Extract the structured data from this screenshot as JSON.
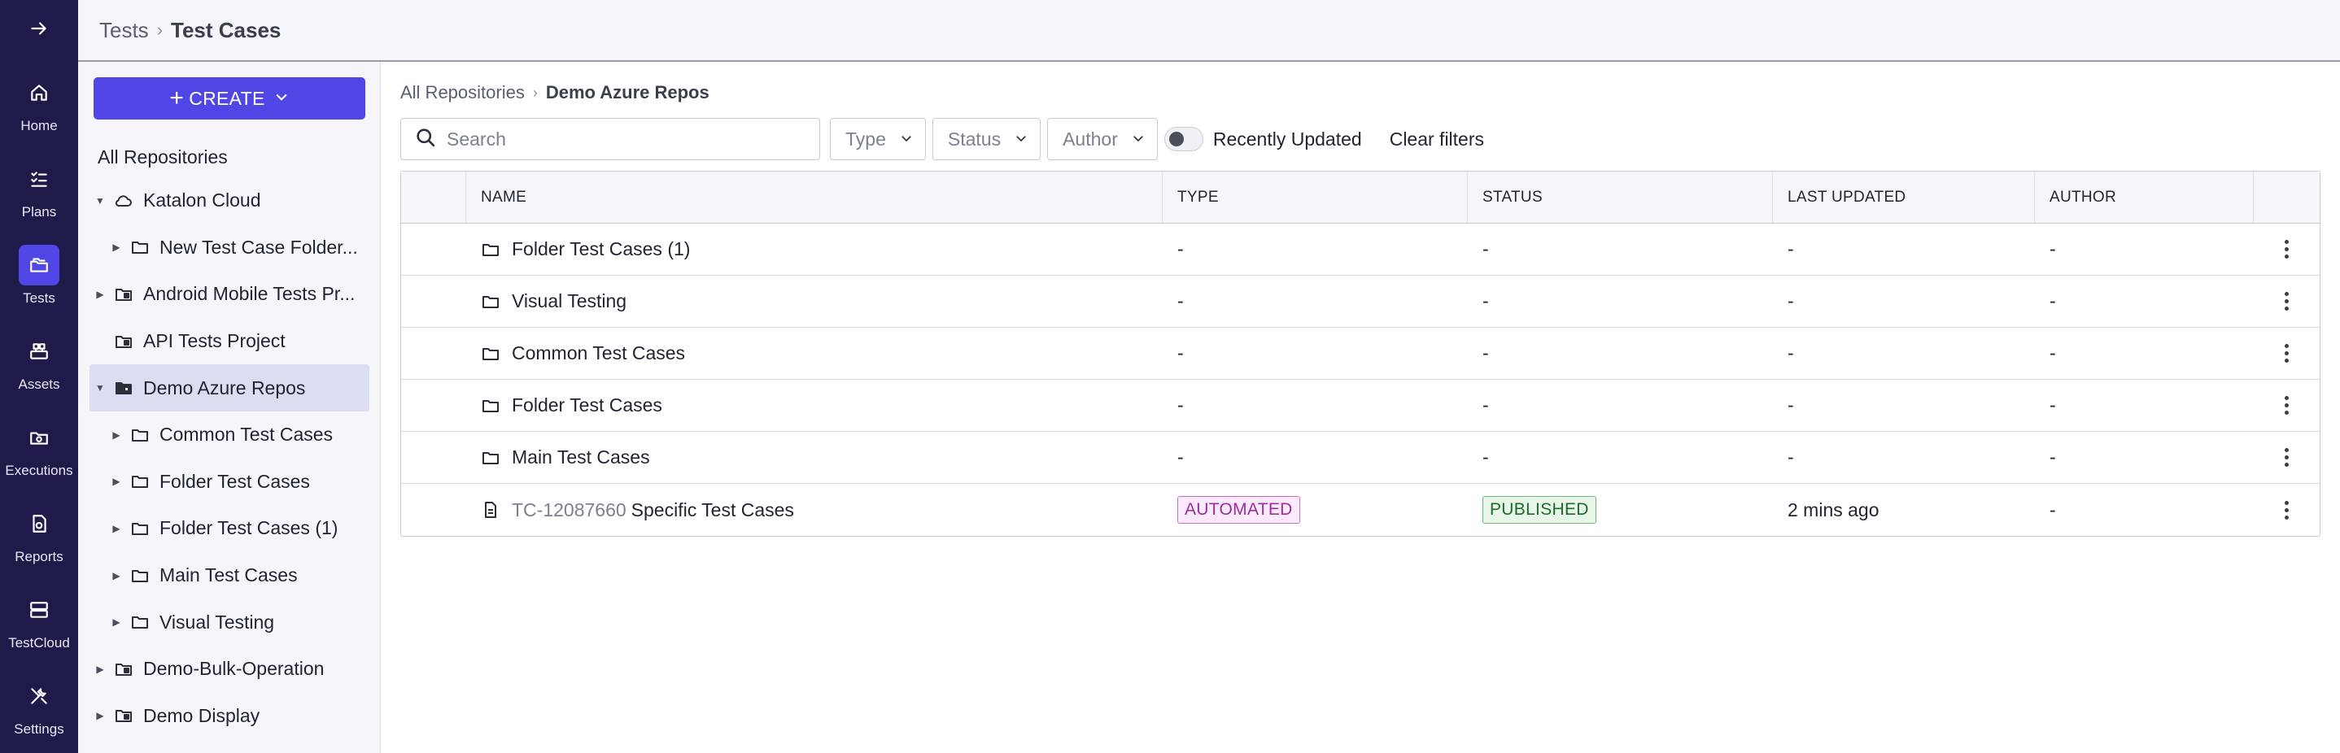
{
  "rail": {
    "toggle_icon": "arrow-right-icon",
    "items": [
      {
        "label": "Home",
        "icon": "home-icon"
      },
      {
        "label": "Plans",
        "icon": "checklist-icon"
      },
      {
        "label": "Tests",
        "icon": "folders-icon",
        "active": true
      },
      {
        "label": "Assets",
        "icon": "assets-icon"
      },
      {
        "label": "Executions",
        "icon": "executions-icon"
      },
      {
        "label": "Reports",
        "icon": "report-icon"
      },
      {
        "label": "TestCloud",
        "icon": "server-icon"
      },
      {
        "label": "Settings",
        "icon": "tools-icon"
      }
    ]
  },
  "header": {
    "breadcrumb_parent": "Tests",
    "breadcrumb_current": "Test Cases"
  },
  "sidebar": {
    "create_label": "CREATE",
    "root_label": "All Repositories",
    "tree": [
      {
        "label": "Katalon Cloud",
        "icon": "cloud-icon",
        "expanded": true
      },
      {
        "label": "New Test Case Folder...",
        "icon": "folder-icon",
        "level": 2
      },
      {
        "label": "Android Mobile Tests Pr...",
        "icon": "repo-icon"
      },
      {
        "label": "API Tests Project",
        "icon": "repo-icon"
      },
      {
        "label": "Demo Azure Repos",
        "icon": "repo-icon",
        "expanded": true,
        "selected": true
      },
      {
        "label": "Common Test Cases",
        "icon": "folder-icon",
        "level": 2
      },
      {
        "label": "Folder Test Cases",
        "icon": "folder-icon",
        "level": 2
      },
      {
        "label": "Folder Test Cases (1)",
        "icon": "folder-icon",
        "level": 2
      },
      {
        "label": "Main Test Cases",
        "icon": "folder-icon",
        "level": 2
      },
      {
        "label": "Visual Testing",
        "icon": "folder-icon",
        "level": 2
      },
      {
        "label": "Demo-Bulk-Operation",
        "icon": "repo-icon"
      },
      {
        "label": "Demo Display",
        "icon": "repo-icon"
      }
    ]
  },
  "main": {
    "breadcrumb_parent": "All Repositories",
    "breadcrumb_current": "Demo Azure Repos",
    "search_placeholder": "Search",
    "filters": {
      "type": "Type",
      "status": "Status",
      "author": "Author",
      "recently_updated": "Recently Updated",
      "recently_updated_on": false,
      "clear": "Clear filters"
    },
    "columns": [
      "NAME",
      "TYPE",
      "STATUS",
      "LAST UPDATED",
      "AUTHOR"
    ],
    "rows": [
      {
        "name": "Folder Test Cases (1)",
        "kind": "folder",
        "type": "-",
        "status": "-",
        "updated": "-",
        "author": "-"
      },
      {
        "name": "Visual Testing",
        "kind": "folder",
        "type": "-",
        "status": "-",
        "updated": "-",
        "author": "-"
      },
      {
        "name": "Common Test Cases",
        "kind": "folder",
        "type": "-",
        "status": "-",
        "updated": "-",
        "author": "-"
      },
      {
        "name": "Folder Test Cases",
        "kind": "folder",
        "type": "-",
        "status": "-",
        "updated": "-",
        "author": "-"
      },
      {
        "name": "Main Test Cases",
        "kind": "folder",
        "type": "-",
        "status": "-",
        "updated": "-",
        "author": "-"
      },
      {
        "id": "TC-12087660",
        "name": "Specific Test Cases",
        "kind": "test-case",
        "type": "AUTOMATED",
        "status": "PUBLISHED",
        "updated": "2 mins ago",
        "author": "-"
      }
    ]
  },
  "colors": {
    "rail_bg": "#1e1b4b",
    "accent": "#4f46e5",
    "selected_row": "#dcdcf2",
    "automated_badge": "#9b2f9b",
    "published_badge": "#1c6b2a"
  }
}
